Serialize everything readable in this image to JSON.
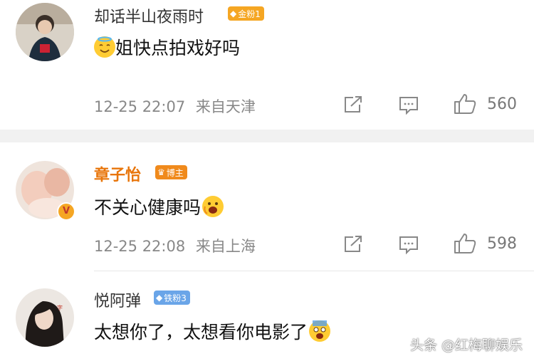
{
  "comments": [
    {
      "username": "却话半山夜雨时",
      "badge": "金粉1",
      "badge_color": "#f5a623",
      "text": "姐快点拍戏好吗",
      "emoji": "halo-smile-emoji",
      "time": "12-25 22:07",
      "location": "来自天津",
      "likes": "560"
    },
    {
      "username": "章子怡",
      "username_color": "#e8750a",
      "badge": "博主",
      "badge_color": "#f08a1c",
      "verified": true,
      "text": "不关心健康吗",
      "emoji": "screaming-emoji",
      "time": "12-25 22:08",
      "location": "来自上海",
      "likes": "598"
    },
    {
      "username": "悦阿弹",
      "badge": "铁粉3",
      "badge_color": "#6aa5e8",
      "text": "太想你了，太想看你电影了",
      "emoji": "scared-emoji"
    }
  ],
  "watermark": "头条 @红梅聊娱乐"
}
